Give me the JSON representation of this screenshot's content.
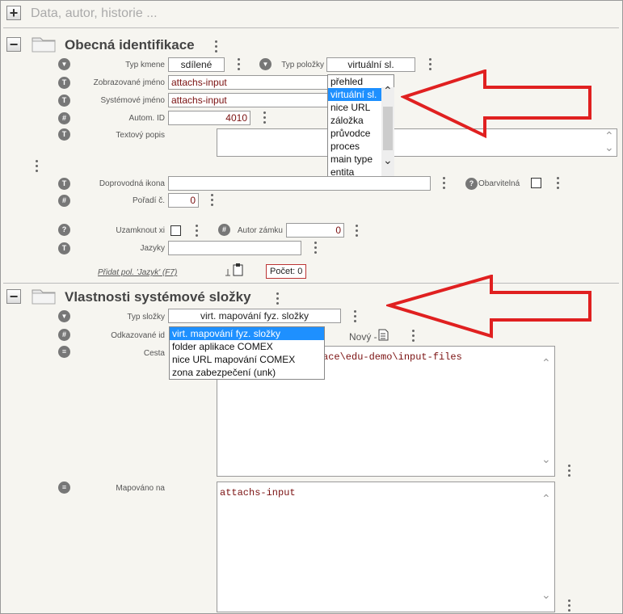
{
  "top": {
    "label": "Data, autor, historie ..."
  },
  "section1": {
    "title": "Obecná identifikace",
    "fields": {
      "typ_kmene": {
        "label": "Typ kmene",
        "value": "sdílené"
      },
      "typ_polozky": {
        "label": "Typ položky",
        "value": "virtuální sl."
      },
      "zobrazovane_jmeno": {
        "label": "Zobrazované jméno",
        "value": "attachs-input"
      },
      "systemove_jmeno": {
        "label": "Systémové jméno",
        "value": "attachs-input"
      },
      "autom_id": {
        "label": "Autom. ID",
        "value": "4010"
      },
      "textovy_popis": {
        "label": "Textový popis",
        "value": ""
      },
      "doprovodna_ikona": {
        "label": "Doprovodná ikona",
        "value": ""
      },
      "obarvitelna": {
        "label": "Obarvitelná"
      },
      "poradi": {
        "label": "Pořadí č.",
        "value": "0"
      },
      "uzamknout": {
        "label": "Uzamknout xi"
      },
      "autor_zamku": {
        "label": "Autor zámku",
        "value": "0"
      },
      "jazyky": {
        "label": "Jazyky",
        "value": ""
      }
    },
    "add_link": "Přidat pol. 'Jazyk' (F7)",
    "count_label": "Počet: 0",
    "type_options": [
      "přehled",
      "virtuální sl.",
      "nice URL",
      "záložka",
      "průvodce",
      "proces",
      "main type",
      "entita"
    ],
    "type_selected_index": 1
  },
  "section2": {
    "title": "Vlastnosti systémové složky",
    "fields": {
      "typ_slozky": {
        "label": "Typ složky",
        "value": "virt. mapování fyz. složky"
      },
      "odkazovane_id": {
        "label": "Odkazované id"
      },
      "novy": {
        "label": "Nový -"
      },
      "cesta": {
        "label": "Cesta",
        "value": "ace\\edu-demo\\input-files"
      },
      "mapovano_na": {
        "label": "Mapováno na",
        "value": "attachs-input"
      }
    },
    "folder_options": [
      "virt. mapování fyz. složky",
      "folder aplikace COMEX",
      "nice URL mapování COMEX",
      "zona zabezpečení (unk)"
    ],
    "folder_selected_index": 0
  },
  "icons": {
    "plus": "+",
    "minus": "−",
    "text_glyph": "T",
    "hash_glyph": "#",
    "question_glyph": "?",
    "triangle_glyph": "▼",
    "lines_glyph": "≡",
    "chevron_up": "⌃",
    "chevron_down": "⌄"
  },
  "colors": {
    "arrow": "#e02020",
    "selection": "#1e90ff",
    "value_text": "#7a1010"
  }
}
